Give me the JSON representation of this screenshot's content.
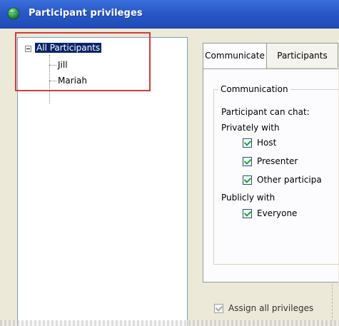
{
  "window": {
    "title": "Participant privileges"
  },
  "tree": {
    "root": "All Participants",
    "children": [
      "Jill",
      "Mariah"
    ]
  },
  "tabs": [
    {
      "label": "Communicate",
      "active": true
    },
    {
      "label": "Participants",
      "active": false
    }
  ],
  "communication": {
    "group_title": "Communication",
    "can_chat_label": "Participant can chat:",
    "privately_label": "Privately with",
    "private_options": [
      {
        "label": "Host",
        "checked": true
      },
      {
        "label": "Presenter",
        "checked": true
      },
      {
        "label": "Other participa",
        "checked": true
      }
    ],
    "publicly_label": "Publicly with",
    "public_options": [
      {
        "label": "Everyone",
        "checked": true
      }
    ]
  },
  "footer": {
    "assign_all_label": "Assign all privileges",
    "assign_all_checked": true,
    "assign_all_disabled": true
  },
  "colors": {
    "titlebar": "#2a59c7",
    "selection": "#0a246a",
    "highlight": "#d33b3b",
    "checkmark": "#21a121"
  }
}
